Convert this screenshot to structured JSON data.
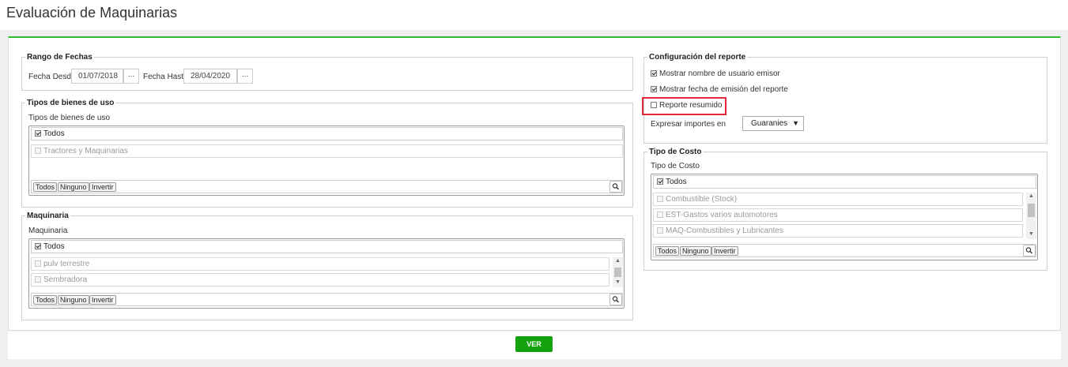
{
  "page": {
    "title": "Evaluación de Maquinarias"
  },
  "colors": {
    "accent_green": "#2fb82f",
    "button_green": "#14a30f",
    "highlight_red": "#e0283a"
  },
  "rango": {
    "legend": "Rango de Fechas",
    "desde_label": "Fecha Desde",
    "desde_value": "01/07/2018",
    "hasta_label": "Fecha Hasta",
    "hasta_value": "28/04/2020",
    "picker_label": "..."
  },
  "tipos_bienes": {
    "legend": "Tipos de bienes de uso",
    "label": "Tipos de bienes de uso",
    "all_label": "Todos",
    "items": [
      "Tractores y Maquinarias"
    ],
    "btn_todos": "Todos",
    "btn_ninguno": "Ninguno",
    "btn_invertir": "Invertir"
  },
  "maquinaria": {
    "legend": "Maquinaria",
    "label": "Maquinaria",
    "all_label": "Todos",
    "items": [
      "pulv terrestre",
      "Sembradora"
    ],
    "btn_todos": "Todos",
    "btn_ninguno": "Ninguno",
    "btn_invertir": "Invertir"
  },
  "config": {
    "legend": "Configuración del reporte",
    "opt1": "Mostrar nombre de usuario emisor",
    "opt1_checked": true,
    "opt2": "Mostrar fecha de emisión del reporte",
    "opt2_checked": true,
    "opt3": "Reporte resumido",
    "opt3_checked": false,
    "expresar_label": "Expresar importes en",
    "currency": "Guaranies"
  },
  "tipo_costo": {
    "legend": "Tipo de Costo",
    "label": "Tipo de Costo",
    "all_label": "Todos",
    "items": [
      "Combustible (Stock)",
      "EST-Gastos varios automotores",
      "MAQ-Combustibles y Lubricantes"
    ],
    "btn_todos": "Todos",
    "btn_ninguno": "Ninguno",
    "btn_invertir": "Invertir"
  },
  "actions": {
    "ver_label": "VER"
  }
}
